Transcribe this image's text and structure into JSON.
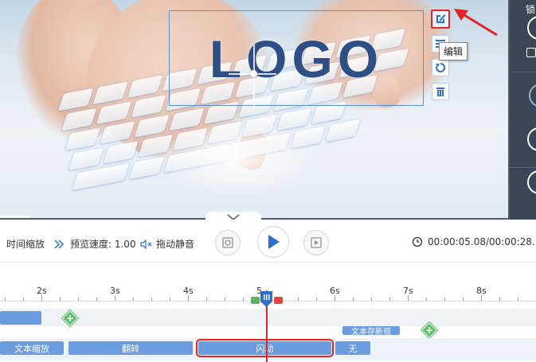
{
  "preview": {
    "logo_text": "LOGO",
    "tooltip": "编辑",
    "tools": [
      "edit-icon",
      "layer-icon",
      "rotate-icon",
      "delete-icon"
    ],
    "selection_color": "#5b8fd8",
    "highlight_color": "#e0242a"
  },
  "side_panel": {
    "label": "锁"
  },
  "controls": {
    "time_zoom_label": "时间缩放",
    "preview_speed_label": "预览速度: 1.00",
    "drag_mute_label": "拖动静音",
    "time_readout": "00:00:05.08/00:00:28."
  },
  "timeline": {
    "ticks": [
      "2s",
      "3s",
      "4s",
      "5",
      "6s",
      "7s",
      "8s"
    ],
    "text_track_clip": "文本存新视",
    "clips": [
      {
        "label": "文本缩放"
      },
      {
        "label": "翻转"
      },
      {
        "label": "闪动"
      },
      {
        "label": "无"
      }
    ],
    "playhead_color": "#e0242a",
    "clip_color": "#6c9ce0"
  }
}
